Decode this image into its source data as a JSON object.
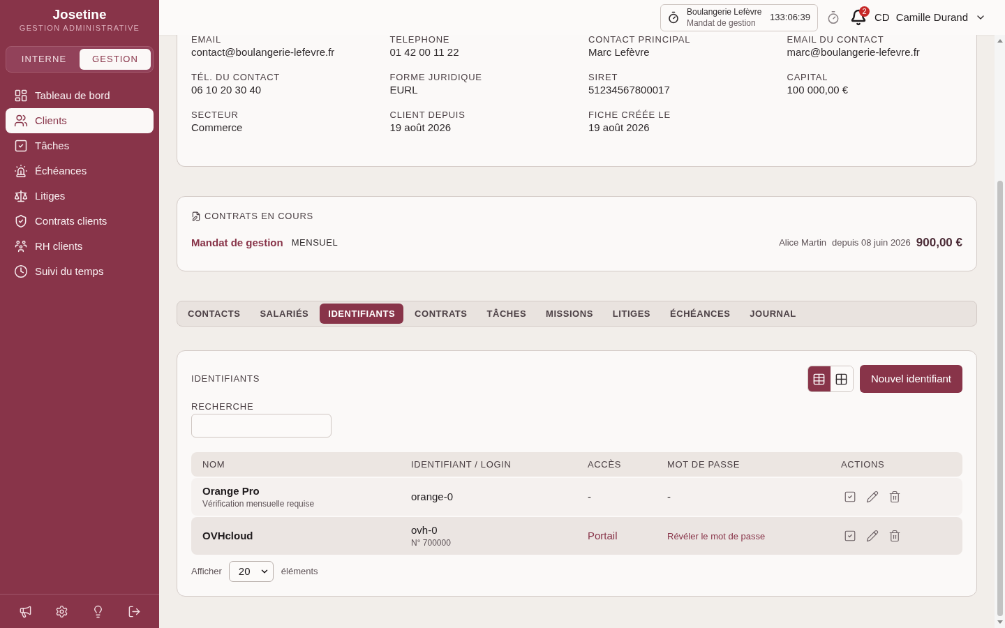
{
  "sidebar": {
    "brand": "Josetine",
    "subtitle": "GESTION ADMINISTRATIVE",
    "modes": [
      {
        "label": "INTERNE",
        "selected": false
      },
      {
        "label": "GESTION",
        "selected": true
      }
    ],
    "items": [
      {
        "label": "Tableau de bord",
        "selected": false
      },
      {
        "label": "Clients",
        "selected": true
      },
      {
        "label": "Tâches",
        "selected": false
      },
      {
        "label": "Échéances",
        "selected": false
      },
      {
        "label": "Litiges",
        "selected": false
      },
      {
        "label": "Contrats clients",
        "selected": false
      },
      {
        "label": "RH clients",
        "selected": false
      },
      {
        "label": "Suivi du temps",
        "selected": false
      }
    ]
  },
  "top_bar": {
    "timer": {
      "client": "Boulangerie Lefèvre",
      "contract": "Mandat de gestion",
      "elapsed": "133:06:39"
    },
    "notification_count": "2",
    "user": {
      "initials": "CD",
      "name": "Camille Durand"
    }
  },
  "client_info": {
    "fields": [
      {
        "label": "EMAIL",
        "value": "contact@boulangerie-lefevre.fr"
      },
      {
        "label": "TELEPHONE",
        "value": "01 42 00 11 22"
      },
      {
        "label": "CONTACT PRINCIPAL",
        "value": "Marc Lefèvre"
      },
      {
        "label": "EMAIL DU CONTACT",
        "value": "marc@boulangerie-lefevre.fr"
      },
      {
        "label": "TÉL. DU CONTACT",
        "value": "06 10 20 30 40"
      },
      {
        "label": "FORME JURIDIQUE",
        "value": "EURL"
      },
      {
        "label": "SIRET",
        "value": "51234567800017"
      },
      {
        "label": "CAPITAL",
        "value": "100 000,00 €"
      },
      {
        "label": "SECTEUR",
        "value": "Commerce"
      },
      {
        "label": "CLIENT DEPUIS",
        "value": "19 août 2026"
      },
      {
        "label": "FICHE CRÉÉE LE",
        "value": "19 août 2026"
      }
    ]
  },
  "contracts": {
    "title": "CONTRATS EN COURS",
    "items": [
      {
        "name": "Mandat de gestion",
        "frequency": "MENSUEL",
        "manager": "Alice Martin",
        "since": "depuis 08 juin 2026",
        "amount": "900,00 €"
      }
    ]
  },
  "tabs": [
    {
      "label": "CONTACTS",
      "selected": false
    },
    {
      "label": "SALARIÉS",
      "selected": false
    },
    {
      "label": "IDENTIFIANTS",
      "selected": true
    },
    {
      "label": "CONTRATS",
      "selected": false
    },
    {
      "label": "TÂCHES",
      "selected": false
    },
    {
      "label": "MISSIONS",
      "selected": false
    },
    {
      "label": "LITIGES",
      "selected": false
    },
    {
      "label": "ÉCHÉANCES",
      "selected": false
    },
    {
      "label": "JOURNAL",
      "selected": false
    }
  ],
  "credentials": {
    "title": "IDENTIFIANTS",
    "views": [
      {
        "kind": "table",
        "selected": true
      },
      {
        "kind": "grid",
        "selected": false
      }
    ],
    "new_button": "Nouvel identifiant",
    "search": {
      "label": "RECHERCHE"
    },
    "table": {
      "columns": [
        "NOM",
        "IDENTIFIANT / LOGIN",
        "ACCÈS",
        "MOT DE PASSE",
        "ACTIONS"
      ],
      "rows": [
        {
          "name": "Orange Pro",
          "note": "Vérification mensuelle requise",
          "login": "orange-0",
          "access": {
            "text": "-",
            "kind": "plain"
          },
          "password": {
            "text": "-",
            "kind": "plain"
          },
          "highlighted": false
        },
        {
          "name": "OVHcloud",
          "login": "ovh-0",
          "login_note": "N° 700000",
          "access": {
            "text": "Portail",
            "kind": "link"
          },
          "password": {
            "text": "Révéler le mot de passe",
            "kind": "link"
          },
          "highlighted": true
        }
      ]
    },
    "pagination": {
      "prefix": "Afficher",
      "page_size": "20",
      "suffix": "éléments"
    }
  }
}
